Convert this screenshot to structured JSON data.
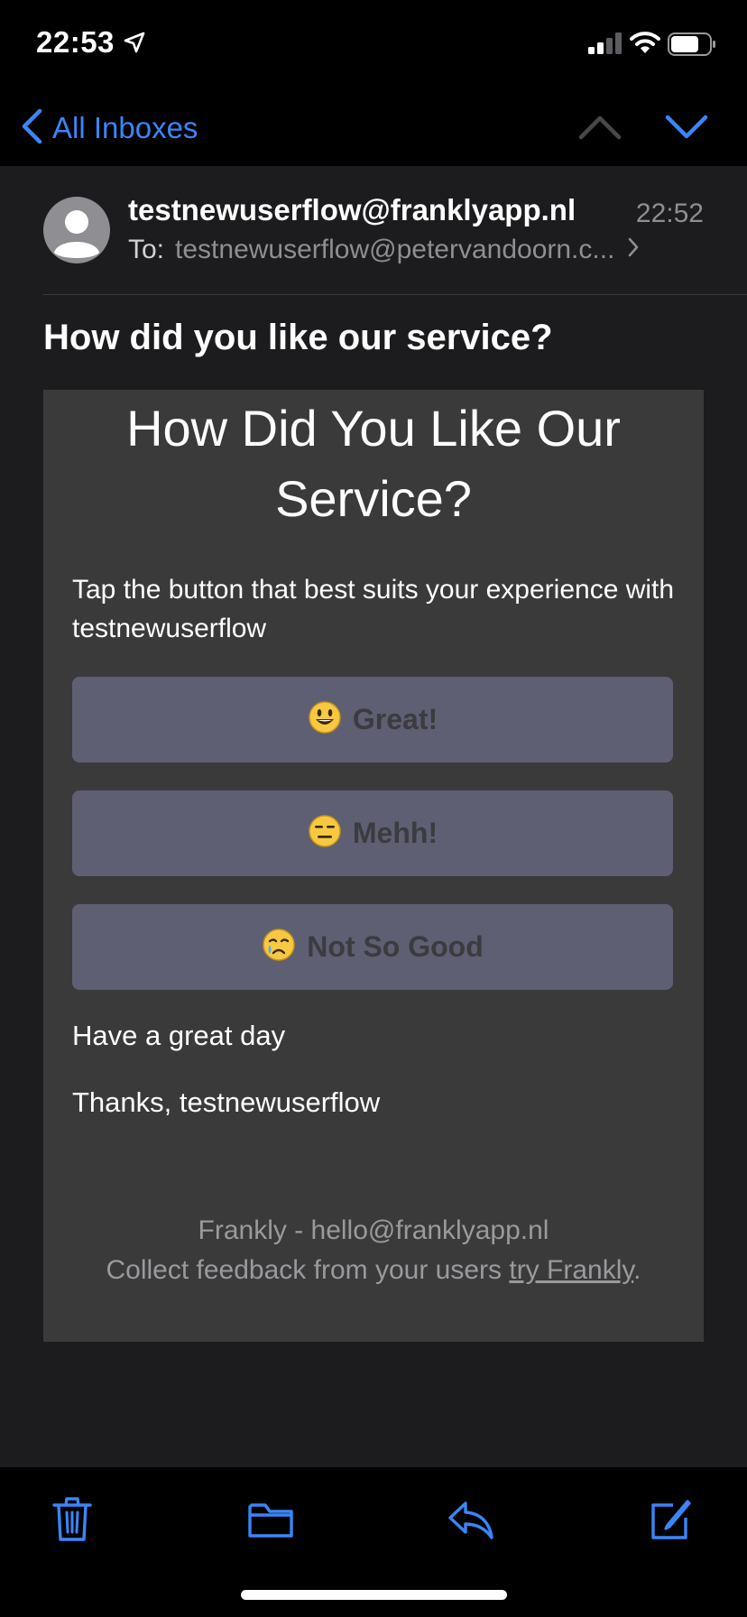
{
  "status_bar": {
    "time": "22:53",
    "icons": [
      "location-arrow-icon",
      "cellular-signal-icon",
      "wifi-icon",
      "battery-icon"
    ]
  },
  "nav": {
    "back_label": "All Inboxes",
    "up_icon": "chevron-up-icon",
    "down_icon": "chevron-down-icon",
    "accent_color": "#3a86f7"
  },
  "message": {
    "sender": "testnewuserflow@franklyapp.nl",
    "time": "22:52",
    "to_label": "To:",
    "to_value": "testnewuserflow@petervandoorn.c...",
    "subject": "How did you like our service?"
  },
  "email_body": {
    "title": "How Did You Like Our Service?",
    "intro": "Tap the button that best suits your experience with testnewuserflow",
    "buttons": [
      {
        "emoji": "😃",
        "label": "Great!"
      },
      {
        "emoji": "😑",
        "label": "Mehh!"
      },
      {
        "emoji": "😢",
        "label": "Not So Good"
      }
    ],
    "closing": "Have a great day",
    "thanks": "Thanks, testnewuserflow",
    "footer_line1": "Frankly - hello@franklyapp.nl",
    "footer_line2_prefix": "Collect feedback from your users ",
    "footer_link": "try Frankly",
    "footer_line2_suffix": ".",
    "button_color": "#5f5f73",
    "card_color": "#3a3a3a"
  },
  "toolbar": {
    "items": [
      "trash-icon",
      "folder-icon",
      "reply-icon",
      "compose-icon"
    ]
  }
}
